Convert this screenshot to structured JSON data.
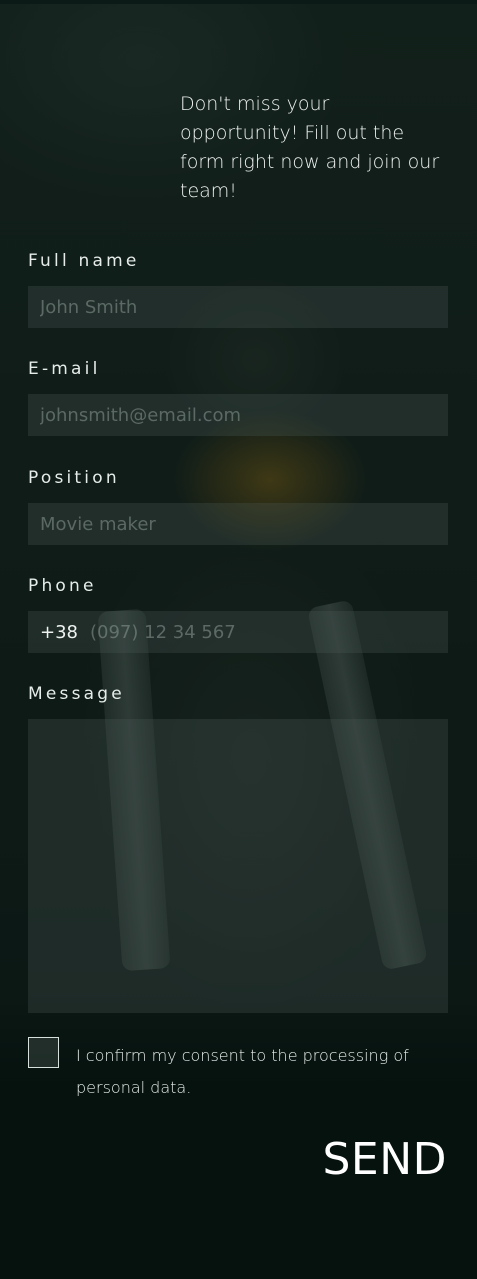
{
  "intro": {
    "text": "Don't miss your opportunity! Fill out the form right now and join our team!"
  },
  "form": {
    "full_name": {
      "label": "Full name",
      "placeholder": "John Smith",
      "value": ""
    },
    "email": {
      "label": "E-mail",
      "placeholder": "johnsmith@email.com",
      "value": ""
    },
    "position": {
      "label": "Position",
      "placeholder": "Movie maker",
      "value": ""
    },
    "phone": {
      "label": "Phone",
      "prefix": "+38",
      "placeholder": "(097) 12 34 567",
      "value": ""
    },
    "message": {
      "label": "Message",
      "placeholder": "",
      "value": ""
    },
    "consent": {
      "label": "I confirm my consent to the processing of personal data.",
      "checked": false
    },
    "send_label": "SEND"
  },
  "colors": {
    "background": "#0b1714",
    "field_bg": "#2c3935",
    "text": "#e6ecea",
    "placeholder": "#5e6c68"
  }
}
